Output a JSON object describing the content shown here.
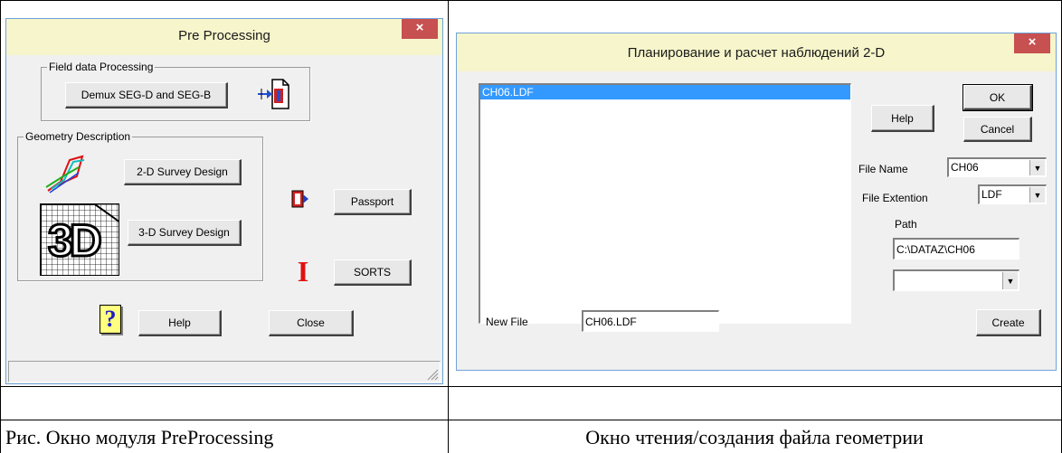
{
  "left_window": {
    "title": "Pre Processing",
    "close_glyph": "×",
    "field_group": "Field data Processing",
    "demux_button": "Demux SEG-D and SEG-B",
    "geometry_group": "Geometry Description",
    "survey_2d_button": "2-D Survey Design",
    "survey_3d_button": "3-D Survey Design",
    "icon_3d_text": "3D",
    "passport_button": "Passport",
    "sorts_icon_text": "I",
    "sorts_button": "SORTS",
    "help_icon_text": "?",
    "help_button": "Help",
    "close_button": "Close"
  },
  "right_window": {
    "title": "Планирование и расчет наблюдений 2-D",
    "close_glyph": "×",
    "list_items": [
      "CH06.LDF"
    ],
    "ok_button": "OK",
    "help_button": "Help",
    "cancel_button": "Cancel",
    "file_name_label": "File Name",
    "file_name_value": "CH06",
    "file_ext_label": "File Extention",
    "file_ext_value": "LDF",
    "path_label": "Path",
    "path_value": "C:\\DATAZ\\CH06",
    "drive_value": "",
    "new_file_label": "New File",
    "new_file_value": "CH06.LDF",
    "create_button": "Create"
  },
  "captions": {
    "left": "Рис. Окно модуля PreProcessing",
    "right": "Окно чтения/создания файла геометрии"
  },
  "colors": {
    "title_bar": "#f6f5cb",
    "close_button": "#c75050",
    "selection": "#3399ff",
    "window_border": "#6fa3d8"
  }
}
